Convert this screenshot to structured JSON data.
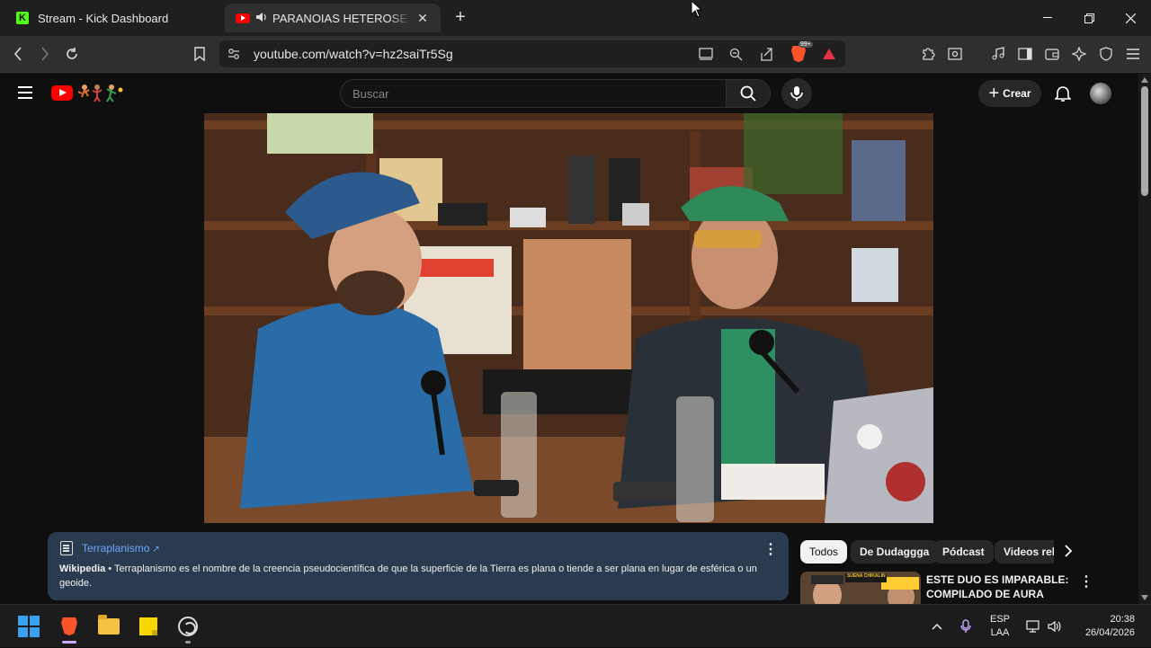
{
  "browser": {
    "tabs": [
      {
        "title": "Stream - Kick Dashboard",
        "favicon": "kick-icon"
      },
      {
        "title": "PARANOIAS HETEROSEXUALES",
        "favicon": "youtube-icon",
        "audio": "speaker-icon"
      }
    ],
    "url": "youtube.com/watch?v=hz2saiTr5Sg",
    "shields_badge": "99+"
  },
  "youtube": {
    "search_placeholder": "Buscar",
    "create_label": "Crear"
  },
  "info_panel": {
    "link_text": "Terraplanismo",
    "source": "Wikipedia",
    "description": " • Terraplanismo es el nombre de la creencia pseudocientífica de que la superficie de la Tierra es plana o tiende a ser plana en lugar de esférica o un geoide."
  },
  "chips": [
    "Todos",
    "De Dudaggga",
    "Pódcast",
    "Videos relacionados"
  ],
  "related": {
    "title": "ESTE DUO ES IMPARABLE: COMPILADO DE AURA CON ...",
    "thumb_text": "SUENA CHIKALIN"
  },
  "taskbar": {
    "lang_line1": "ESP",
    "lang_line2": "LAA",
    "time": "20:38",
    "date": "26/04/2026"
  },
  "colors": {
    "accent_red": "#ff0000",
    "kick_green": "#53fc18",
    "info_panel_bg": "#2a3a4f",
    "link_blue": "#6ea8fe"
  }
}
